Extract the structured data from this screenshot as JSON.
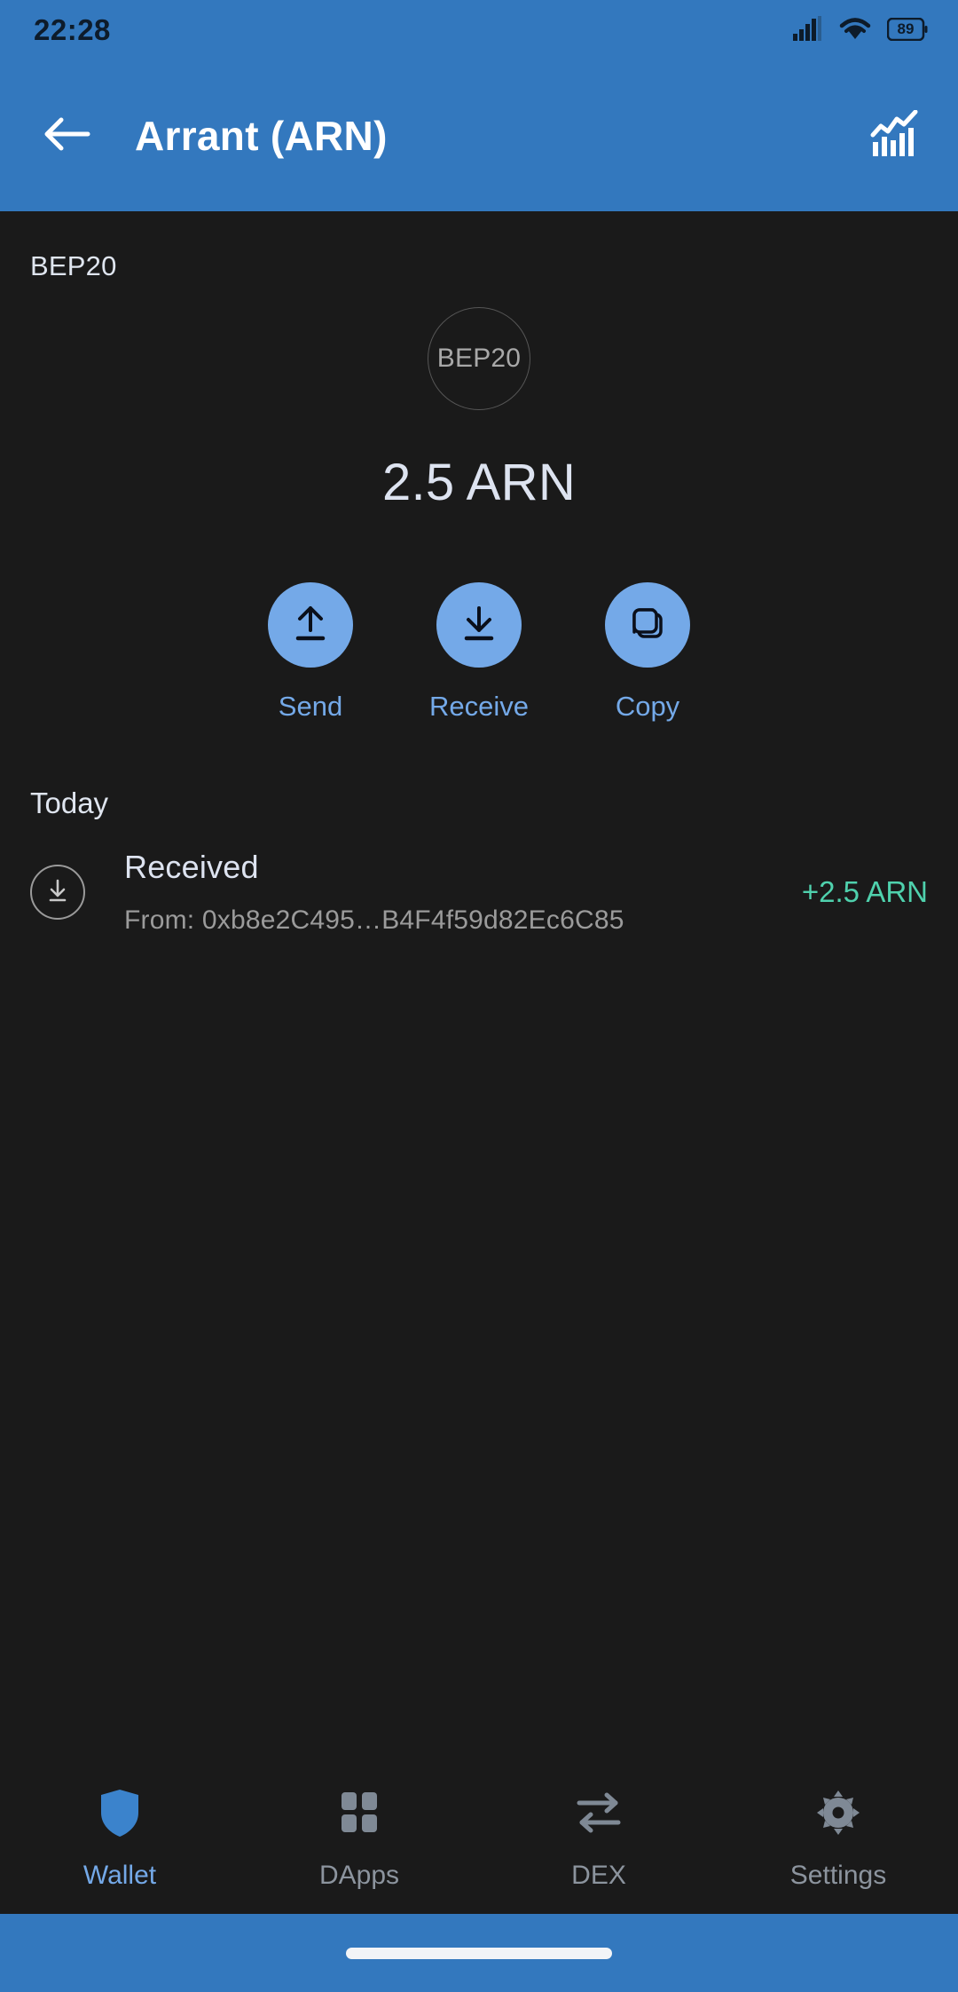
{
  "status_bar": {
    "time": "22:28",
    "battery_level": "89",
    "icons": [
      "signal-icon",
      "wifi-icon",
      "battery-icon"
    ]
  },
  "app_bar": {
    "title": "Arrant (ARN)",
    "back_icon": "arrow-left-icon",
    "chart_icon": "chart-icon",
    "background_color": "#3378be"
  },
  "token": {
    "network_label": "BEP20",
    "avatar_text": "BEP20",
    "balance": "2.5 ARN"
  },
  "actions": [
    {
      "label": "Send",
      "icon": "upload-arrow-icon"
    },
    {
      "label": "Receive",
      "icon": "download-arrow-icon"
    },
    {
      "label": "Copy",
      "icon": "copy-icon"
    }
  ],
  "transactions": {
    "section_header": "Today",
    "items": [
      {
        "icon": "download-circle-icon",
        "title": "Received",
        "subtitle": "From: 0xb8e2C495…B4F4f59d82Ec6C85",
        "amount": "+2.5 ARN",
        "amount_color": "#4fd1ad"
      }
    ]
  },
  "bottom_nav": {
    "items": [
      {
        "label": "Wallet",
        "icon": "shield-icon",
        "active": true
      },
      {
        "label": "DApps",
        "icon": "grid-icon",
        "active": false
      },
      {
        "label": "DEX",
        "icon": "swap-arrows-icon",
        "active": false
      },
      {
        "label": "Settings",
        "icon": "gear-icon",
        "active": false
      }
    ],
    "active_color": "#74a9e8",
    "inactive_color": "#8c949e"
  },
  "colors": {
    "accent_blue": "#74a9e8",
    "header_blue": "#3378be",
    "background": "#1a1a1a",
    "positive_green": "#4fd1ad"
  }
}
